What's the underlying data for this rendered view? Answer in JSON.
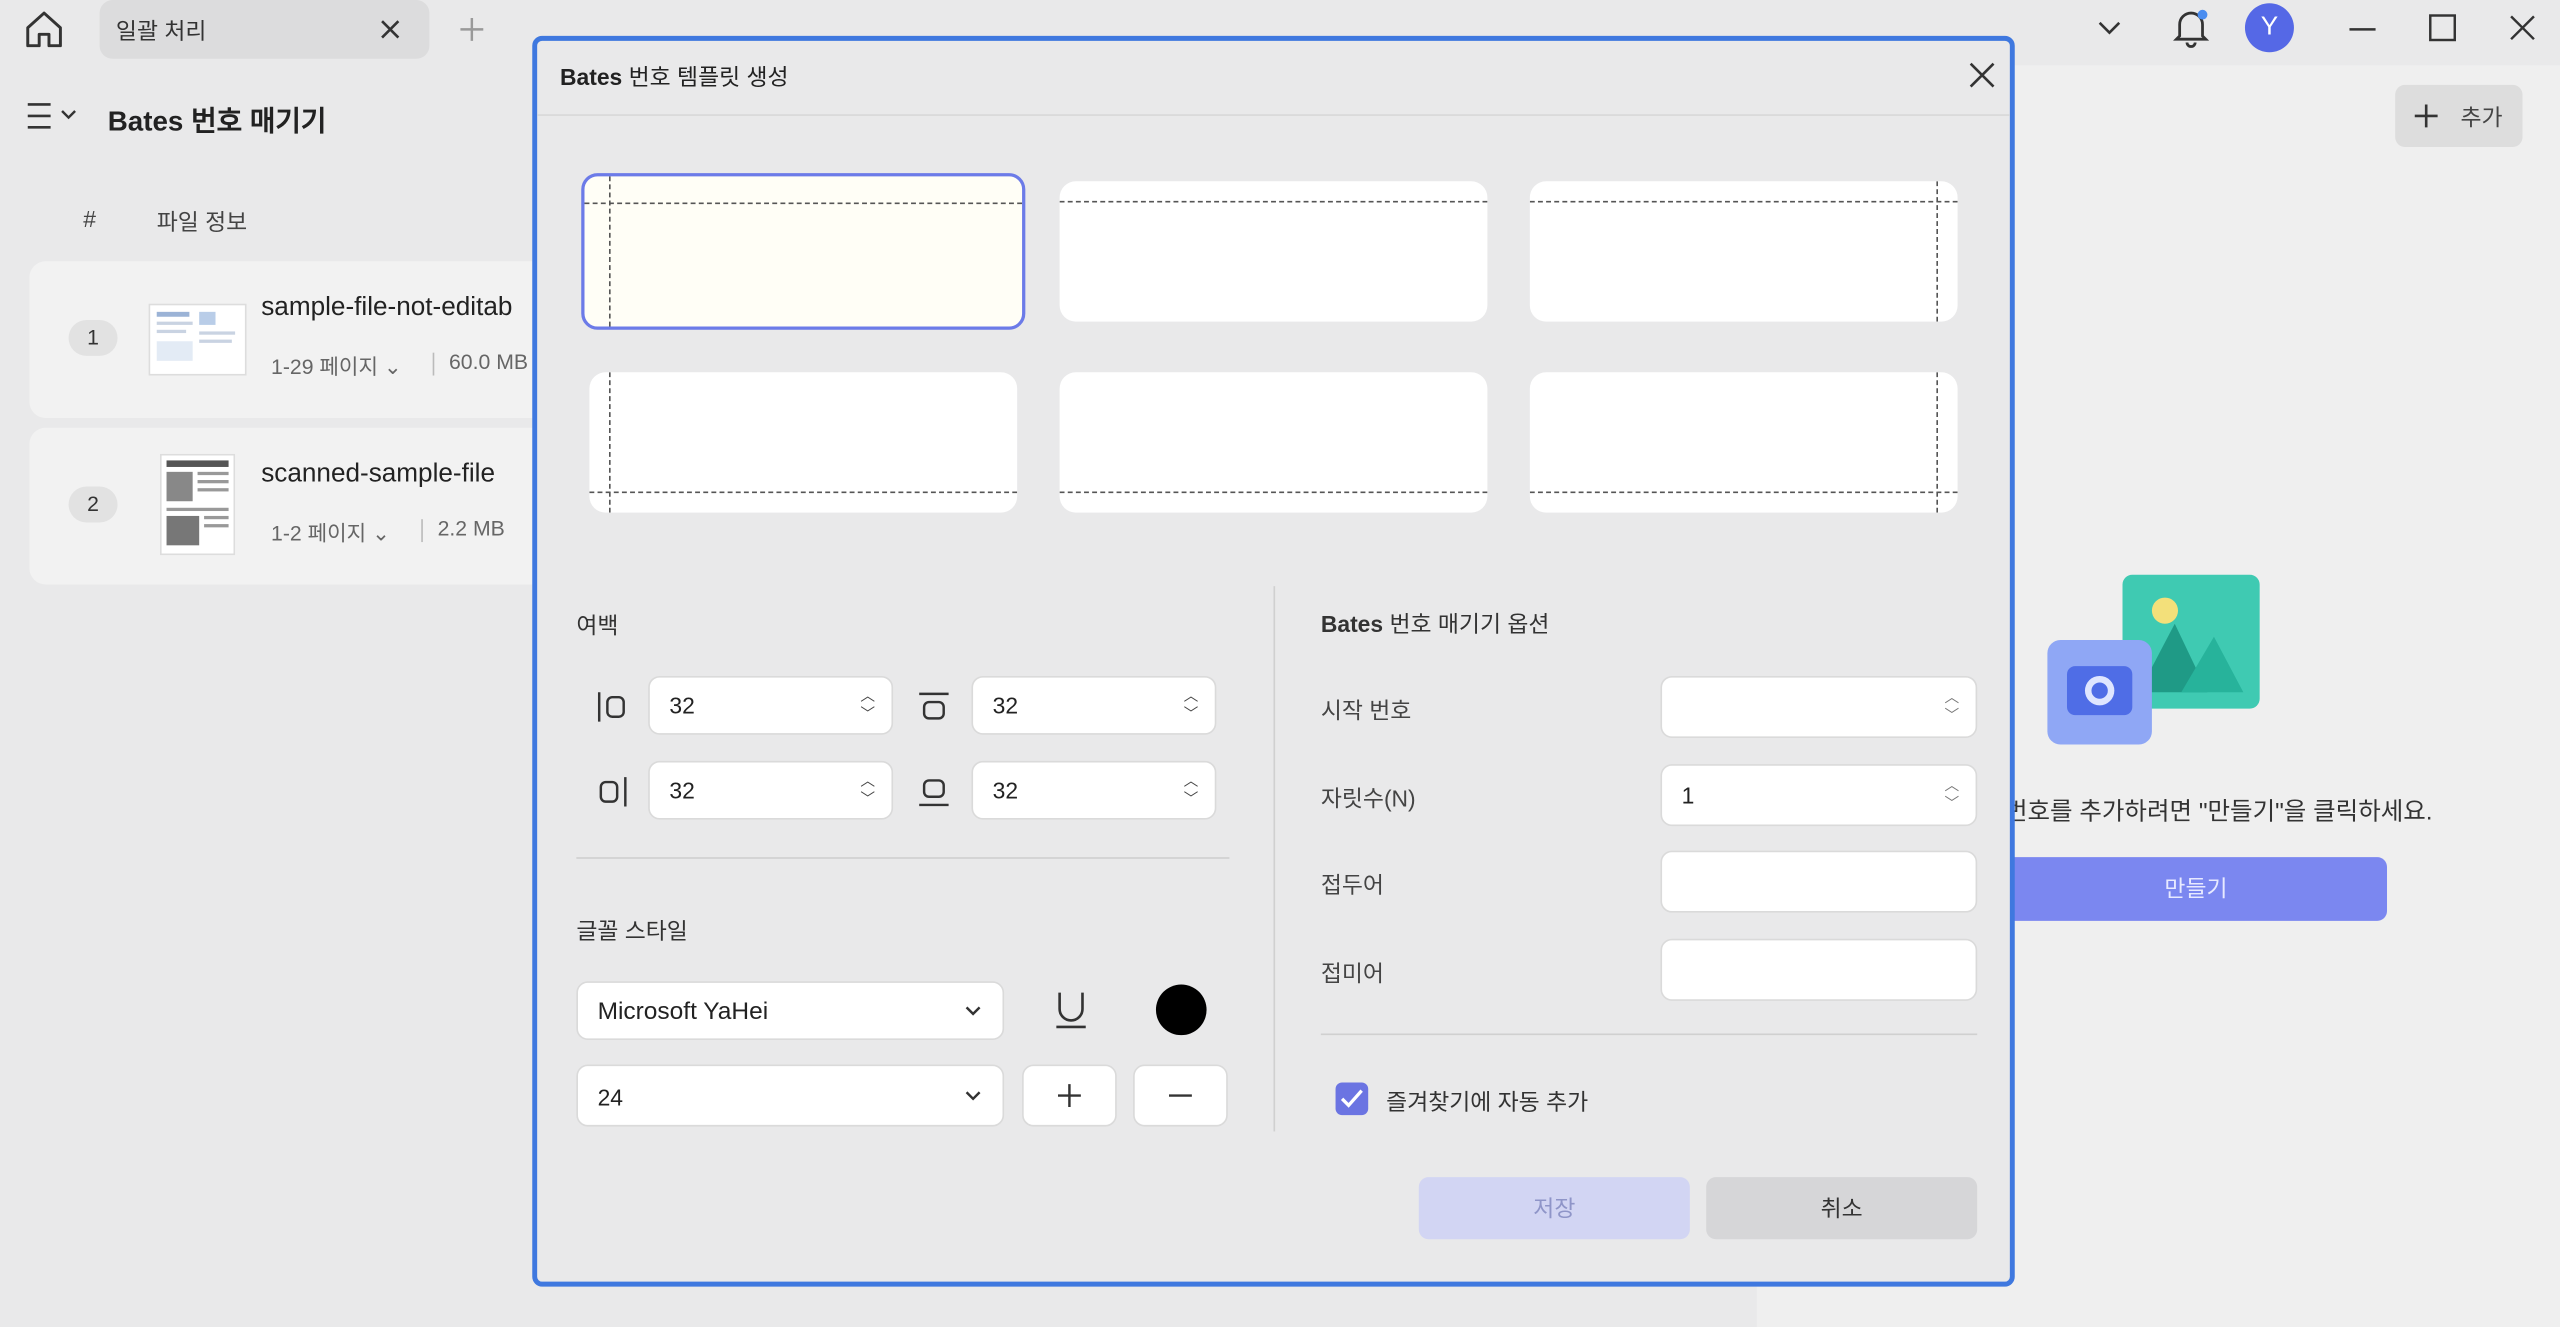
{
  "window": {
    "tab_label": "일괄 처리",
    "avatar_letter": "Y"
  },
  "app": {
    "title": "Bates 번호 매기기",
    "columns": {
      "index": "#",
      "info": "파일 정보"
    },
    "files": [
      {
        "index": "1",
        "name": "sample-file-not-editab",
        "pages": "1-29 페이지",
        "size": "60.0 MB"
      },
      {
        "index": "2",
        "name": "scanned-sample-file",
        "pages": "1-2 페이지",
        "size": "2.2 MB"
      }
    ],
    "add_button": "추가",
    "hint": "번호를 추가하려면 \"만들기\"을 클릭하세요.",
    "make_button": "만들기"
  },
  "modal": {
    "title_bold": "Bates",
    "title_rest": " 번호 템플릿 생성",
    "selected_template_index": 0,
    "margin": {
      "label": "여백",
      "left": "32",
      "top": "32",
      "right": "32",
      "bottom": "32"
    },
    "font": {
      "label": "글꼴 스타일",
      "family": "Microsoft YaHei",
      "size": "24",
      "color": "#000000"
    },
    "options": {
      "title_bold": "Bates",
      "title_rest": " 번호 매기기 옵션",
      "start_number_label": "시작 번호",
      "start_number_value": "",
      "digits_label": "자릿수(N)",
      "digits_value": "1",
      "prefix_label": "접두어",
      "prefix_value": "",
      "suffix_label": "접미어",
      "suffix_value": "",
      "favorites_checkbox_label": "즐겨찾기에 자동 추가",
      "favorites_checked": true
    },
    "save_button": "저장",
    "cancel_button": "취소"
  },
  "colors": {
    "accent": "#3f78df",
    "primary_button": "#7b87f0",
    "checkbox": "#6b74e2"
  }
}
